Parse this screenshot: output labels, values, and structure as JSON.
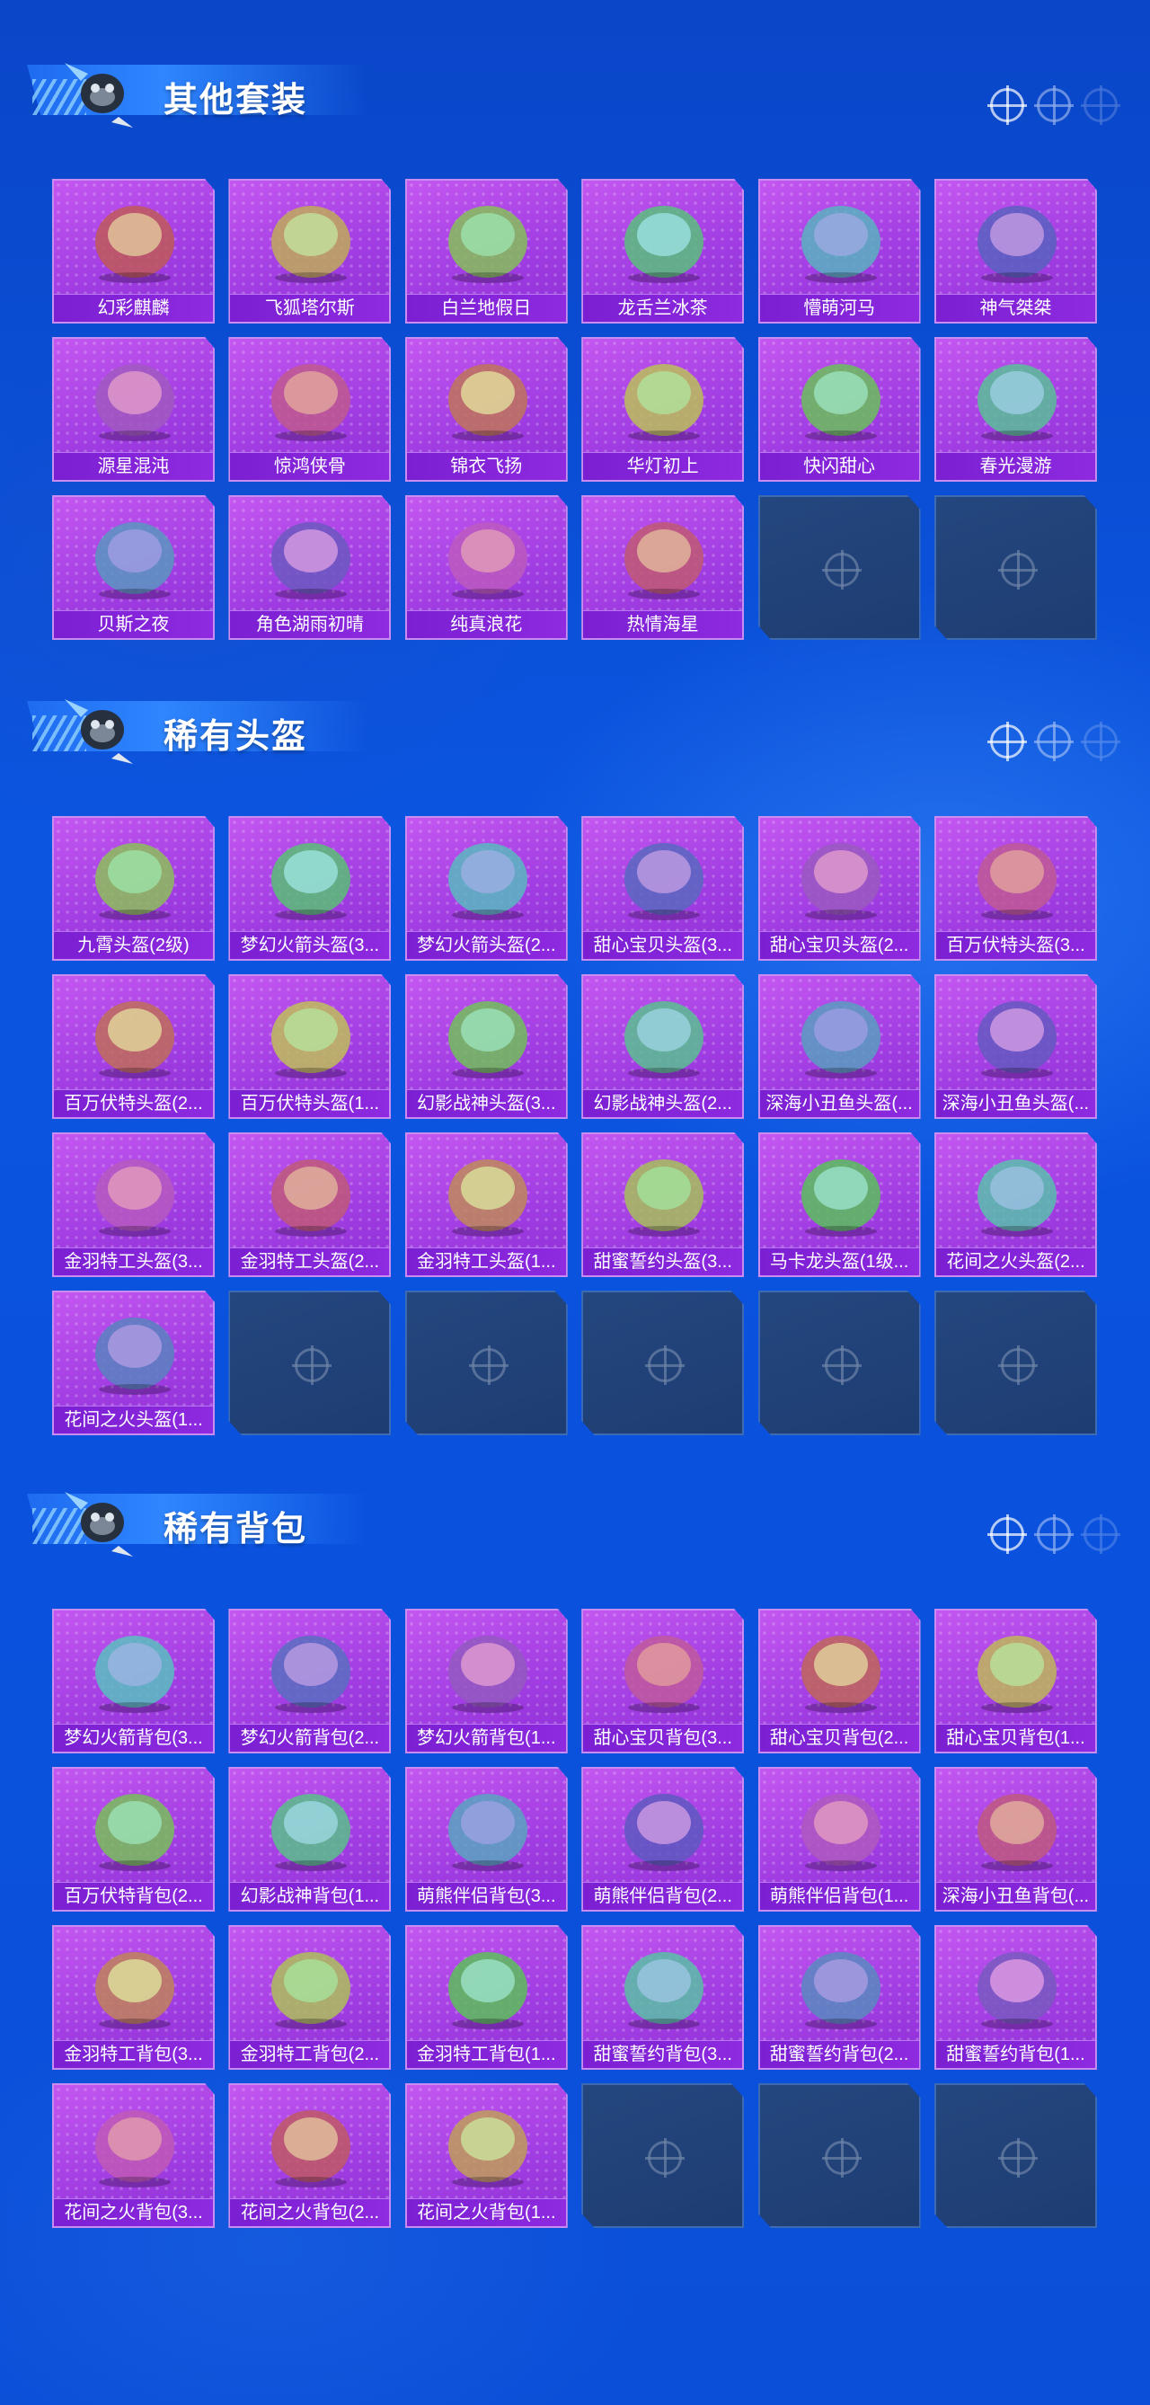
{
  "sections": [
    {
      "title": "其他套装",
      "items": [
        "幻彩麒麟",
        "飞狐塔尔斯",
        "白兰地假日",
        "龙舌兰冰茶",
        "懵萌河马",
        "神气桀桀",
        "源星混沌",
        "惊鸿侠骨",
        "锦衣飞扬",
        "华灯初上",
        "快闪甜心",
        "春光漫游",
        "贝斯之夜",
        "角色湖雨初晴",
        "纯真浪花",
        "热情海星"
      ],
      "empty_slots": 2
    },
    {
      "title": "稀有头盔",
      "items": [
        "九霄头盔(2级)",
        "梦幻火箭头盔(3...",
        "梦幻火箭头盔(2...",
        "甜心宝贝头盔(3...",
        "甜心宝贝头盔(2...",
        "百万伏特头盔(3...",
        "百万伏特头盔(2...",
        "百万伏特头盔(1...",
        "幻影战神头盔(3...",
        "幻影战神头盔(2...",
        "深海小丑鱼头盔(...",
        "深海小丑鱼头盔(...",
        "金羽特工头盔(3...",
        "金羽特工头盔(2...",
        "金羽特工头盔(1...",
        "甜蜜誓约头盔(3...",
        "马卡龙头盔(1级...",
        "花间之火头盔(2...",
        "花间之火头盔(1..."
      ],
      "empty_slots": 5
    },
    {
      "title": "稀有背包",
      "items": [
        "梦幻火箭背包(3...",
        "梦幻火箭背包(2...",
        "梦幻火箭背包(1...",
        "甜心宝贝背包(3...",
        "甜心宝贝背包(2...",
        "甜心宝贝背包(1...",
        "百万伏特背包(2...",
        "幻影战神背包(1...",
        "萌熊伴侣背包(3...",
        "萌熊伴侣背包(2...",
        "萌熊伴侣背包(1...",
        "深海小丑鱼背包(...",
        "金羽特工背包(3...",
        "金羽特工背包(2...",
        "金羽特工背包(1...",
        "甜蜜誓约背包(3...",
        "甜蜜誓约背包(2...",
        "甜蜜誓约背包(1...",
        "花间之火背包(3...",
        "花间之火背包(2...",
        "花间之火背包(1..."
      ],
      "empty_slots": 3
    }
  ],
  "colors": {
    "background": "#0b55e0",
    "card_purple": "#a23ee3",
    "card_label": "#7b1fd2",
    "empty_slot": "#24477f"
  },
  "icons": {
    "header_mascot": "mascot-icon",
    "header_decoration": "crosshair-icon",
    "empty_slot": "crosshair-icon",
    "item_art": "item-art-icon"
  }
}
